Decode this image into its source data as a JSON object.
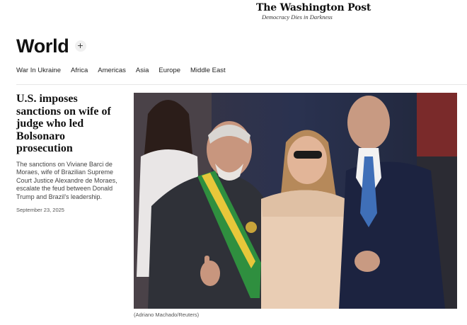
{
  "masthead": {
    "logo": "The Washington Post",
    "tagline": "Democracy Dies in Darkness"
  },
  "section": {
    "title": "World",
    "follow_label": "+"
  },
  "subnav": [
    {
      "label": "War In Ukraine"
    },
    {
      "label": "Africa"
    },
    {
      "label": "Americas"
    },
    {
      "label": "Asia"
    },
    {
      "label": "Europe"
    },
    {
      "label": "Middle East"
    }
  ],
  "story": {
    "headline": "U.S. imposes sanctions on wife of judge who led Bolsonaro prosecution",
    "blurb": "The sanctions on Viviane Barci de Moraes, wife of Brazilian Supreme Court Justice Alexandre de Moraes, escalate the feud between Donald Trump and Brazil’s leadership.",
    "date": "September 23, 2025",
    "photo_credit": "(Adriano Machado/Reuters)"
  },
  "colors": {
    "background": "#ffffff",
    "text": "#111111",
    "muted": "#444444"
  }
}
